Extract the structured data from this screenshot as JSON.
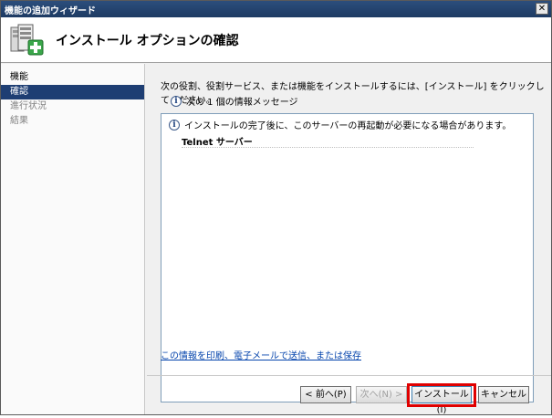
{
  "window": {
    "title": "機能の追加ウィザード",
    "close_glyph": "✕"
  },
  "header": {
    "title": "インストール オプションの確認",
    "icon": "server-add-icon"
  },
  "sidebar": {
    "items": [
      {
        "label": "機能",
        "state": "normal"
      },
      {
        "label": "確認",
        "state": "active"
      },
      {
        "label": "進行状況",
        "state": "disabled"
      },
      {
        "label": "結果",
        "state": "disabled"
      }
    ]
  },
  "main": {
    "instruction": "次の役割、役割サービス、または機能をインストールするには、[インストール] をクリックしてください。",
    "message_count": "次の 1 個の情報メッセージ",
    "info_glyph": "i",
    "list": {
      "message": "インストールの完了後に、このサーバーの再起動が必要になる場合があります。",
      "feature": "Telnet サーバー"
    },
    "print_link": "この情報を印刷、電子メールで送信、または保存"
  },
  "buttons": {
    "prev": "< 前へ(P)",
    "next": "次へ(N) >",
    "install": "インストール(I)",
    "cancel": "キャンセル"
  },
  "colors": {
    "title_bar": "#1d3a63",
    "active_item": "#1e3e73",
    "highlight": "#e00000"
  }
}
